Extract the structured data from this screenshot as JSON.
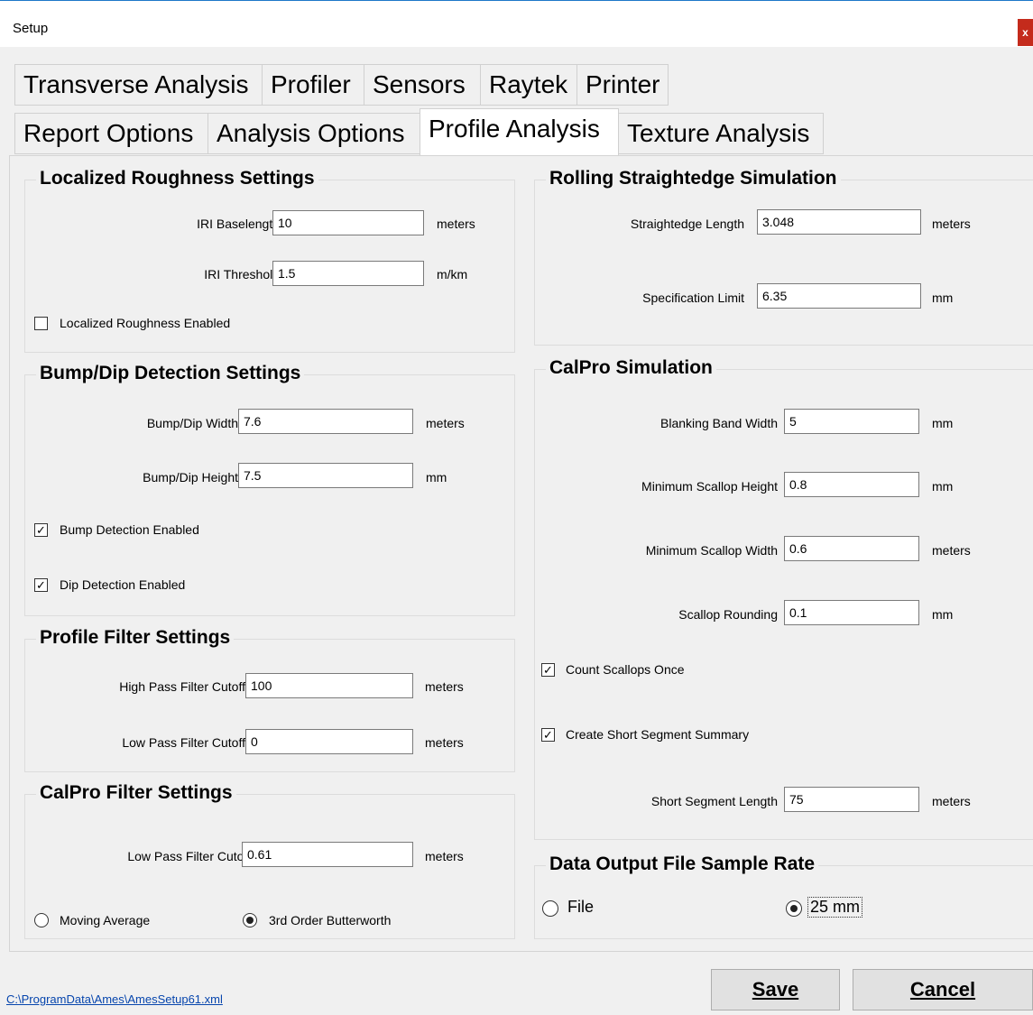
{
  "window": {
    "title": "Setup",
    "close_glyph": "x"
  },
  "tabs_row1": [
    "Transverse Analysis",
    "Profiler",
    "Sensors",
    "Raytek",
    "Printer"
  ],
  "tabs_row2": [
    "Report Options",
    "Analysis Options",
    "Profile Analysis",
    "Texture Analysis"
  ],
  "active_tab": "Profile Analysis",
  "localized": {
    "title": "Localized Roughness Settings",
    "baselength_label": "IRI Baselength",
    "baselength_value": "10",
    "baselength_unit": "meters",
    "threshold_label": "IRI Threshold",
    "threshold_value": "1.5",
    "threshold_unit": "m/km",
    "enabled_label": "Localized Roughness Enabled",
    "enabled_checked": false
  },
  "bumpdip": {
    "title": "Bump/Dip Detection Settings",
    "width_label": "Bump/Dip Width",
    "width_value": "7.6",
    "width_unit": "meters",
    "height_label": "Bump/Dip Height",
    "height_value": "7.5",
    "height_unit": "mm",
    "bump_label": "Bump Detection Enabled",
    "bump_checked": true,
    "dip_label": "Dip Detection Enabled",
    "dip_checked": true
  },
  "profile_filter": {
    "title": "Profile Filter Settings",
    "high_label": "High Pass Filter Cutoff",
    "high_value": "100",
    "high_unit": "meters",
    "low_label": "Low Pass Filter Cutoff",
    "low_value": "0",
    "low_unit": "meters"
  },
  "calpro_filter": {
    "title": "CalPro Filter Settings",
    "low_label": "Low Pass Filter Cutoff",
    "low_value": "0.61",
    "low_unit": "meters",
    "moving_label": "Moving Average",
    "moving_selected": false,
    "butter_label": "3rd Order Butterworth",
    "butter_selected": true
  },
  "rolling": {
    "title": "Rolling Straightedge Simulation",
    "length_label": "Straightedge Length",
    "length_value": "3.048",
    "length_unit": "meters",
    "spec_label": "Specification Limit",
    "spec_value": "6.35",
    "spec_unit": "mm"
  },
  "calpro_sim": {
    "title": "CalPro Simulation",
    "blank_label": "Blanking Band Width",
    "blank_value": "5",
    "blank_unit": "mm",
    "minh_label": "Minimum Scallop Height",
    "minh_value": "0.8",
    "minh_unit": "mm",
    "minw_label": "Minimum Scallop Width",
    "minw_value": "0.6",
    "minw_unit": "meters",
    "round_label": "Scallop Rounding",
    "round_value": "0.1",
    "round_unit": "mm",
    "count_label": "Count Scallops Once",
    "count_checked": true,
    "summary_label": "Create Short Segment Summary",
    "summary_checked": true,
    "seglen_label": "Short Segment Length",
    "seglen_value": "75",
    "seglen_unit": "meters"
  },
  "sample_rate": {
    "title": "Data Output File Sample Rate",
    "file_label": "File",
    "file_selected": false,
    "mm_label": "25 mm",
    "mm_selected": true
  },
  "buttons": {
    "save": "Save",
    "cancel": "Cancel"
  },
  "footer": {
    "path": "C:\\ProgramData\\Ames\\AmesSetup61.xml"
  }
}
